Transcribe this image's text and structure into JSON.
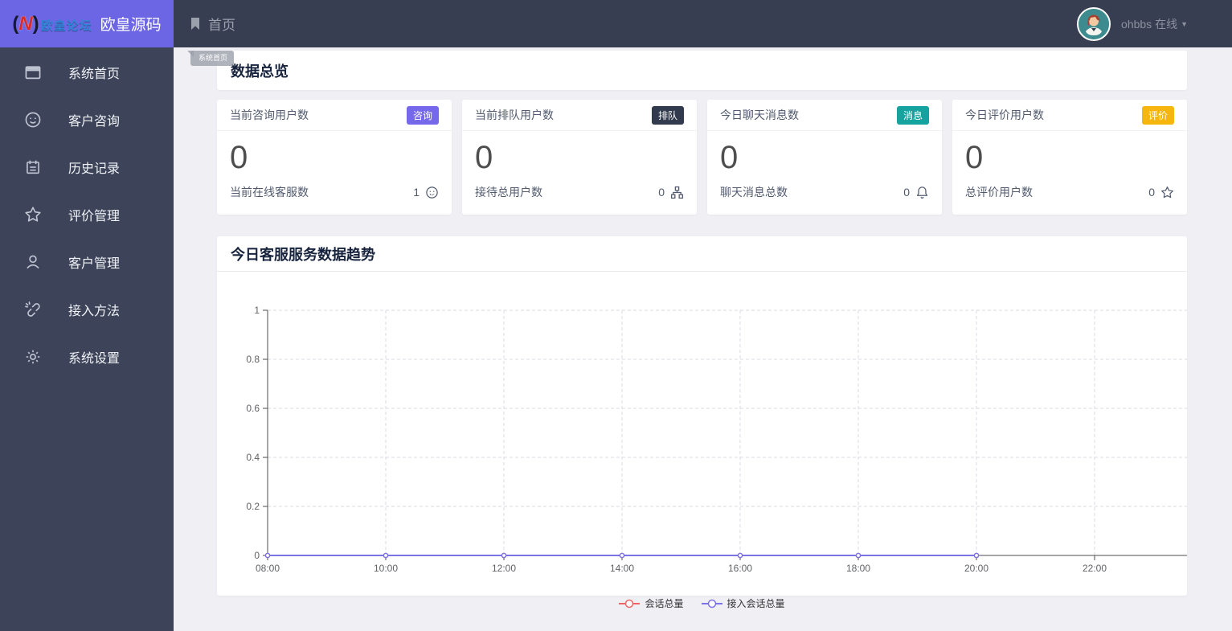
{
  "brand": {
    "logo_paren_left": "(",
    "logo_letter": "N",
    "logo_paren_right": ")",
    "logo_subtitle": "欧皇论坛",
    "title": "欧皇源码"
  },
  "topbar": {
    "nav_label": "首页",
    "user_name": "ohbbs 在线",
    "caret": "▼"
  },
  "page_tab": {
    "label": "系统首页"
  },
  "sidebar": {
    "items": [
      {
        "label": "系统首页",
        "icon": "window-icon"
      },
      {
        "label": "客户咨询",
        "icon": "smiley-icon"
      },
      {
        "label": "历史记录",
        "icon": "notebook-icon"
      },
      {
        "label": "评价管理",
        "icon": "star-icon"
      },
      {
        "label": "客户管理",
        "icon": "user-icon"
      },
      {
        "label": "接入方法",
        "icon": "broken-link-icon"
      },
      {
        "label": "系统设置",
        "icon": "gear-icon"
      }
    ]
  },
  "overview": {
    "title": "数据总览",
    "cards": [
      {
        "title": "当前咨询用户数",
        "badge": "咨询",
        "badge_color": "#7668ea",
        "value": "0",
        "footer_label": "当前在线客服数",
        "footer_value": "1",
        "icon": "smiley-icon"
      },
      {
        "title": "当前排队用户数",
        "badge": "排队",
        "badge_color": "#323a4d",
        "value": "0",
        "footer_label": "接待总用户数",
        "footer_value": "0",
        "icon": "org-group-icon"
      },
      {
        "title": "今日聊天消息数",
        "badge": "消息",
        "badge_color": "#16a3a0",
        "value": "0",
        "footer_label": "聊天消息总数",
        "footer_value": "0",
        "icon": "bell-icon"
      },
      {
        "title": "今日评价用户数",
        "badge": "评价",
        "badge_color": "#f6b60e",
        "value": "0",
        "footer_label": "总评价用户数",
        "footer_value": "0",
        "icon": "star-icon"
      }
    ]
  },
  "chart_panel": {
    "title": "今日客服服务数据趋势"
  },
  "chart_data": {
    "type": "line",
    "x": [
      "08:00",
      "10:00",
      "12:00",
      "14:00",
      "16:00",
      "18:00",
      "20:00"
    ],
    "x_axis_ticks": [
      "08:00",
      "10:00",
      "12:00",
      "14:00",
      "16:00",
      "18:00",
      "20:00",
      "22:00"
    ],
    "series": [
      {
        "name": "会话总量",
        "color": "#ee6666",
        "values": [
          0,
          0,
          0,
          0,
          0,
          0,
          0
        ]
      },
      {
        "name": "接入会话总量",
        "color": "#7d73e8",
        "values": [
          0,
          0,
          0,
          0,
          0,
          0,
          0
        ]
      }
    ],
    "ylim": [
      0,
      1
    ],
    "y_ticks": [
      0,
      0.2,
      0.4,
      0.6,
      0.8,
      1
    ],
    "grid": true,
    "legend_position": "bottom"
  }
}
